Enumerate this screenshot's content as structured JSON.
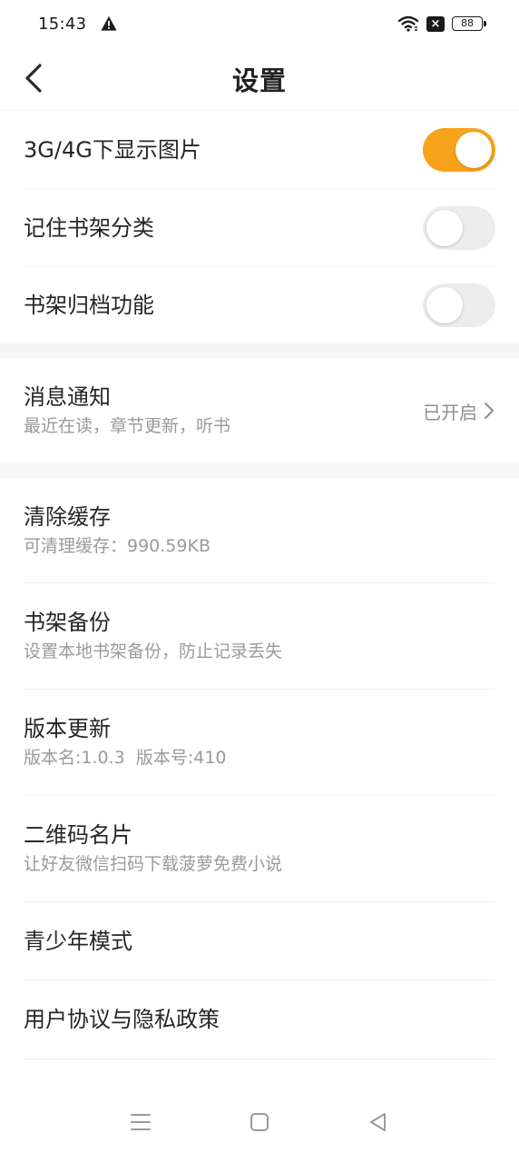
{
  "status": {
    "time": "15:43",
    "battery": "88"
  },
  "header": {
    "title": "设置"
  },
  "toggles": [
    {
      "label": "3G/4G下显示图片",
      "on": true
    },
    {
      "label": "记住书架分类",
      "on": false
    },
    {
      "label": "书架归档功能",
      "on": false
    }
  ],
  "notification": {
    "title": "消息通知",
    "subtitle": "最近在读，章节更新，听书",
    "value": "已开启"
  },
  "items": [
    {
      "title": "清除缓存",
      "subtitle": "可清理缓存：990.59KB"
    },
    {
      "title": "书架备份",
      "subtitle": "设置本地书架备份，防止记录丢失"
    },
    {
      "title": "版本更新",
      "subtitle": "版本名:1.0.3  版本号:410"
    },
    {
      "title": "二维码名片",
      "subtitle": "让好友微信扫码下载菠萝免费小说"
    },
    {
      "title": "青少年模式"
    },
    {
      "title": "用户协议与隐私政策"
    }
  ],
  "colors": {
    "accent": "#f7a21b",
    "toggle_off": "#ececec"
  }
}
